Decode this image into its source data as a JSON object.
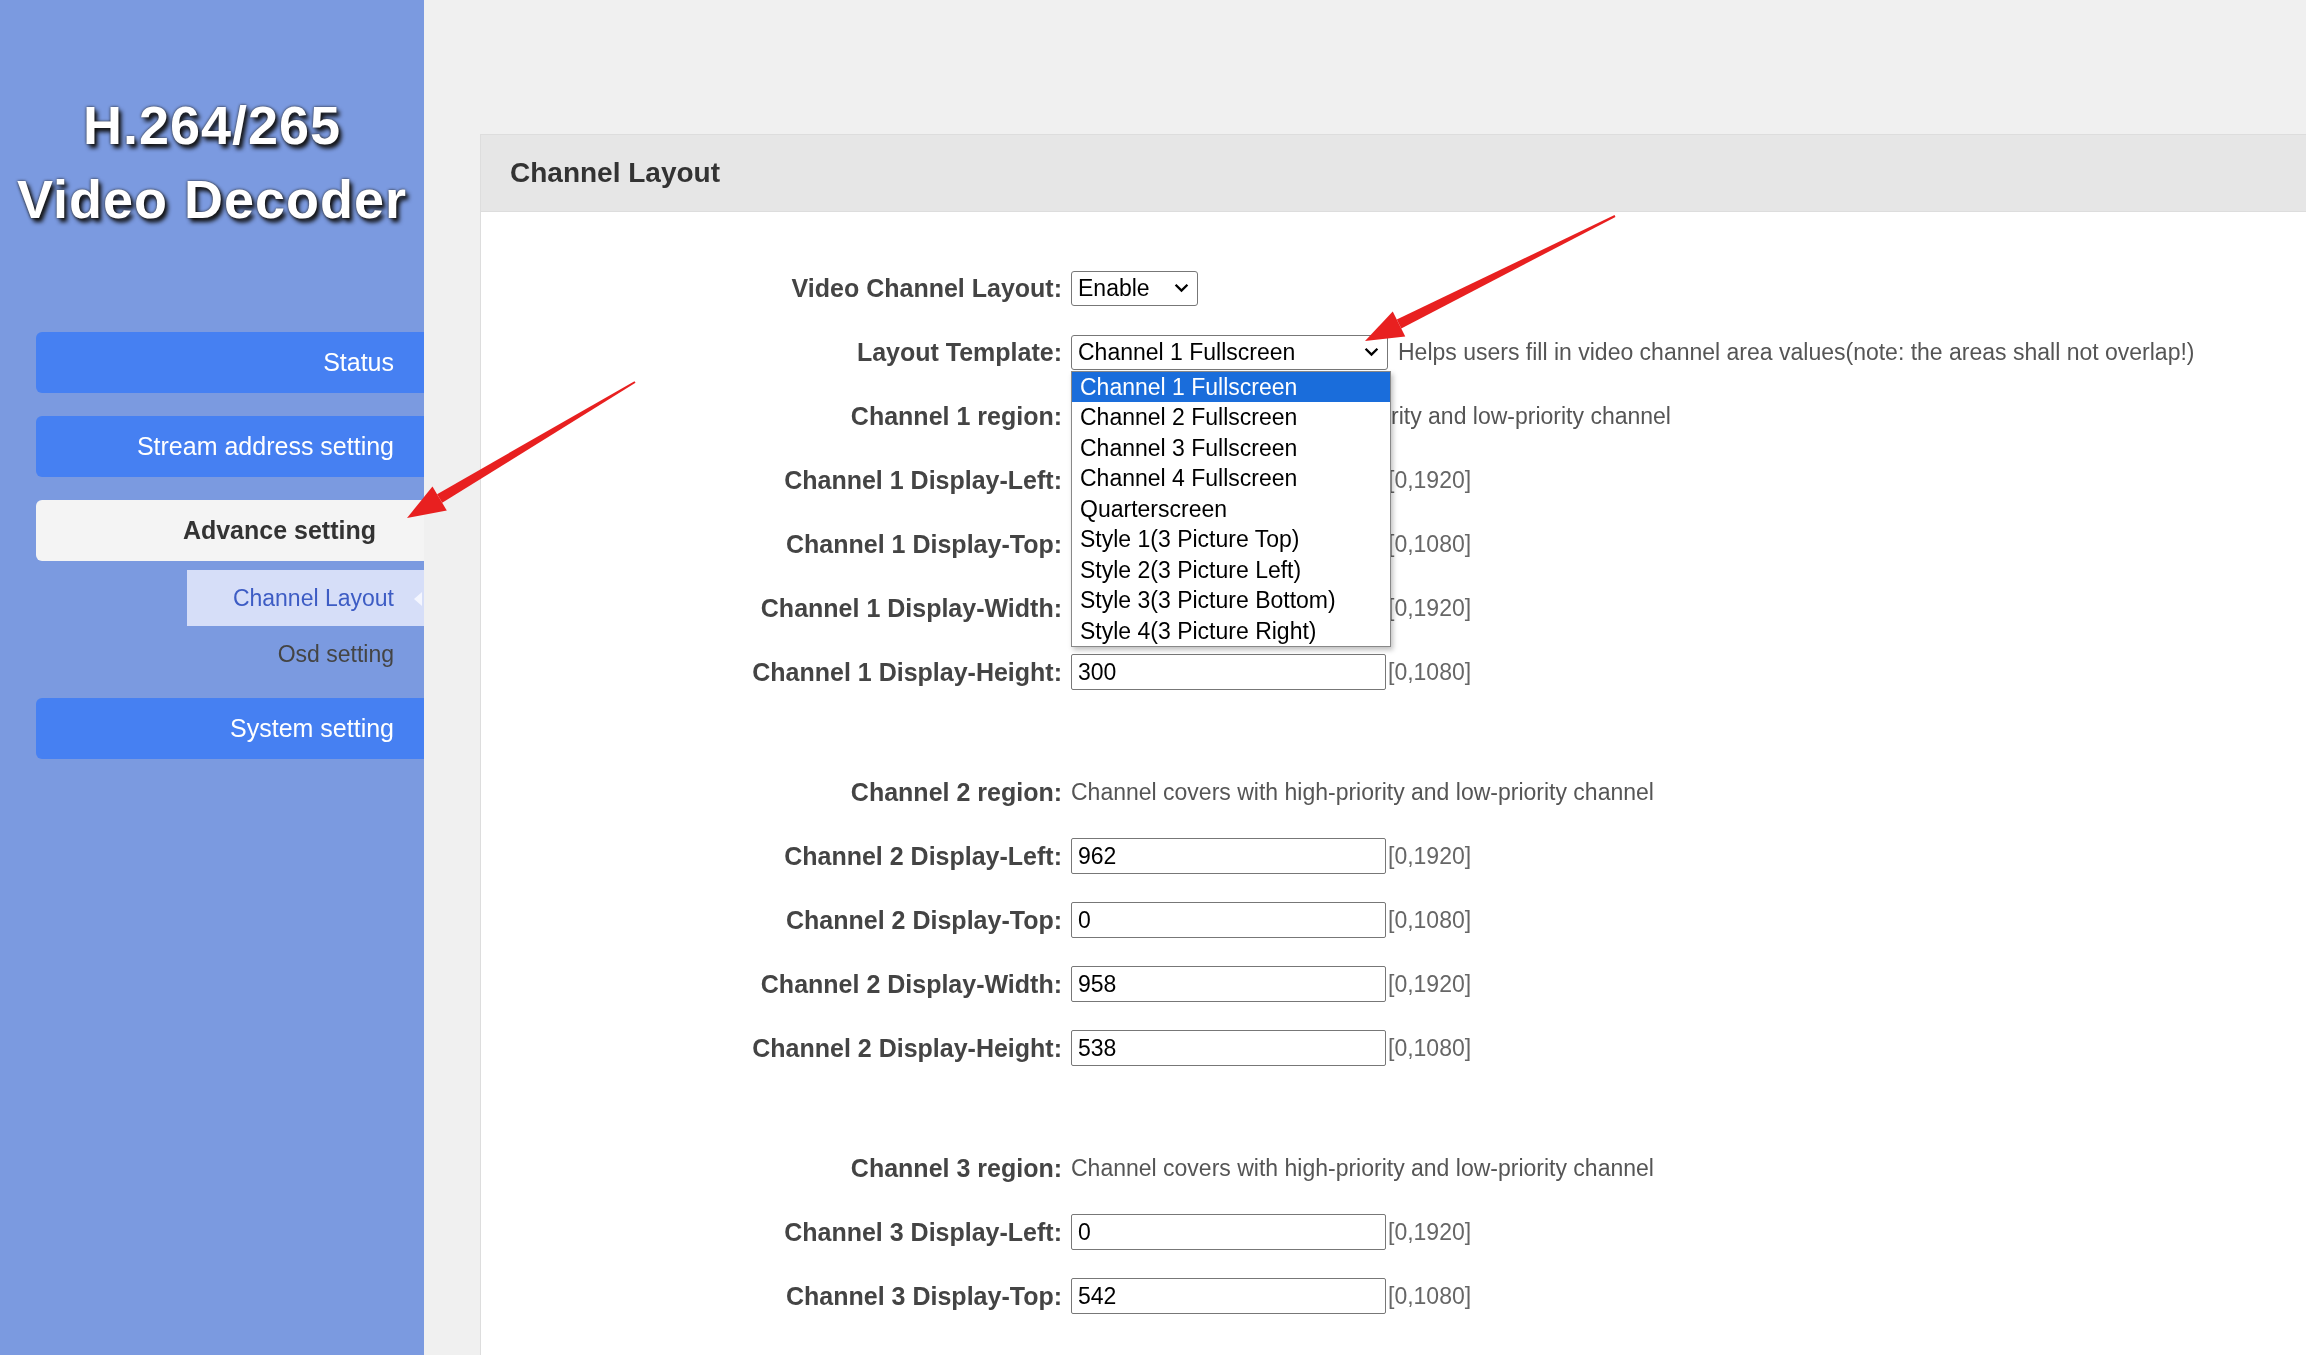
{
  "sidebar": {
    "logo_lines": [
      "H.264/265",
      "Video Decoder"
    ],
    "nav": [
      {
        "label": "Status",
        "selected": false
      },
      {
        "label": "Stream address setting",
        "selected": false
      },
      {
        "label": "Advance setting",
        "selected": true,
        "children": [
          {
            "label": "Channel Layout",
            "selected": true
          },
          {
            "label": "Osd setting",
            "selected": false
          }
        ]
      },
      {
        "label": "System setting",
        "selected": false
      }
    ]
  },
  "panel": {
    "title": "Channel Layout",
    "sections": [
      [
        {
          "kind": "select",
          "label": "Video Channel Layout:",
          "value": "Enable"
        },
        {
          "kind": "dropdown",
          "label": "Layout Template:",
          "value": "Channel 1 Fullscreen",
          "hint": "Helps users fill in video channel area values(note: the areas shall not overlap!)",
          "options": [
            {
              "label": "Channel 1 Fullscreen",
              "selected": true
            },
            {
              "label": "Channel 2 Fullscreen",
              "selected": false
            },
            {
              "label": "Channel 3 Fullscreen",
              "selected": false
            },
            {
              "label": "Channel 4 Fullscreen",
              "selected": false
            },
            {
              "label": "Quarterscreen",
              "selected": false
            },
            {
              "label": "Style 1(3 Picture Top)",
              "selected": false
            },
            {
              "label": "Style 2(3 Picture Left)",
              "selected": false
            },
            {
              "label": "Style 3(3 Picture Bottom)",
              "selected": false
            },
            {
              "label": "Style 4(3 Picture Right)",
              "selected": false
            }
          ]
        },
        {
          "kind": "region",
          "label": "Channel 1 region:",
          "hint": "rity and low-priority channel",
          "covered": true
        },
        {
          "kind": "number",
          "label": "Channel 1 Display-Left:",
          "range": "[0,1920]"
        },
        {
          "kind": "number",
          "label": "Channel 1 Display-Top:",
          "range": "[0,1080]"
        },
        {
          "kind": "number",
          "label": "Channel 1 Display-Width:",
          "range": "[0,1920]"
        },
        {
          "kind": "number",
          "label": "Channel 1 Display-Height:",
          "value": "300",
          "range": "[0,1080]"
        }
      ],
      [
        {
          "kind": "region",
          "label": "Channel 2 region:",
          "hint": "Channel covers with high-priority and low-priority channel"
        },
        {
          "kind": "number",
          "label": "Channel 2 Display-Left:",
          "value": "962",
          "range": "[0,1920]"
        },
        {
          "kind": "number",
          "label": "Channel 2 Display-Top:",
          "value": "0",
          "range": "[0,1080]"
        },
        {
          "kind": "number",
          "label": "Channel 2 Display-Width:",
          "value": "958",
          "range": "[0,1920]"
        },
        {
          "kind": "number",
          "label": "Channel 2 Display-Height:",
          "value": "538",
          "range": "[0,1080]"
        }
      ],
      [
        {
          "kind": "region",
          "label": "Channel 3 region:",
          "hint": "Channel covers with high-priority and low-priority channel"
        },
        {
          "kind": "number",
          "label": "Channel 3 Display-Left:",
          "value": "0",
          "range": "[0,1920]"
        },
        {
          "kind": "number",
          "label": "Channel 3 Display-Top:",
          "value": "542",
          "range": "[0,1080]"
        }
      ]
    ]
  }
}
